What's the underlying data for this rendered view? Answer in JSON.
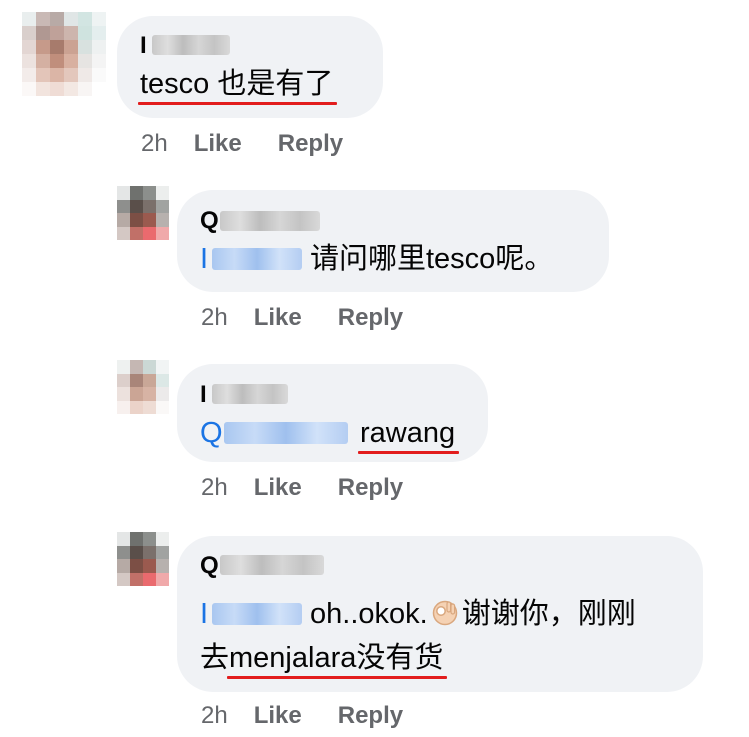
{
  "comments": [
    {
      "author_initial": "I",
      "text": "tesco 也是有了",
      "time": "2h",
      "like_label": "Like",
      "reply_label": "Reply"
    },
    {
      "author_initial": "Q",
      "mention_initial": "I",
      "text": "请问哪里tesco呢。",
      "time": "2h",
      "like_label": "Like",
      "reply_label": "Reply"
    },
    {
      "author_initial": "I",
      "mention_initial": "Q",
      "text": "rawang",
      "time": "2h",
      "like_label": "Like",
      "reply_label": "Reply"
    },
    {
      "author_initial": "Q",
      "mention_initial": "I",
      "text_line1": "oh..okok.",
      "emoji": "ok-hand-emoji",
      "text_line1_after": "谢谢你，刚刚",
      "text_line2_a": "去",
      "text_line2_underlined": "menjalara",
      "text_line2_b": "没有货",
      "time": "2h",
      "like_label": "Like",
      "reply_label": "Reply"
    }
  ],
  "colors": {
    "bubble": "#f0f2f5",
    "meta": "#65676b",
    "mention": "#1b74e4",
    "annotation_underline": "#e21d1d"
  }
}
